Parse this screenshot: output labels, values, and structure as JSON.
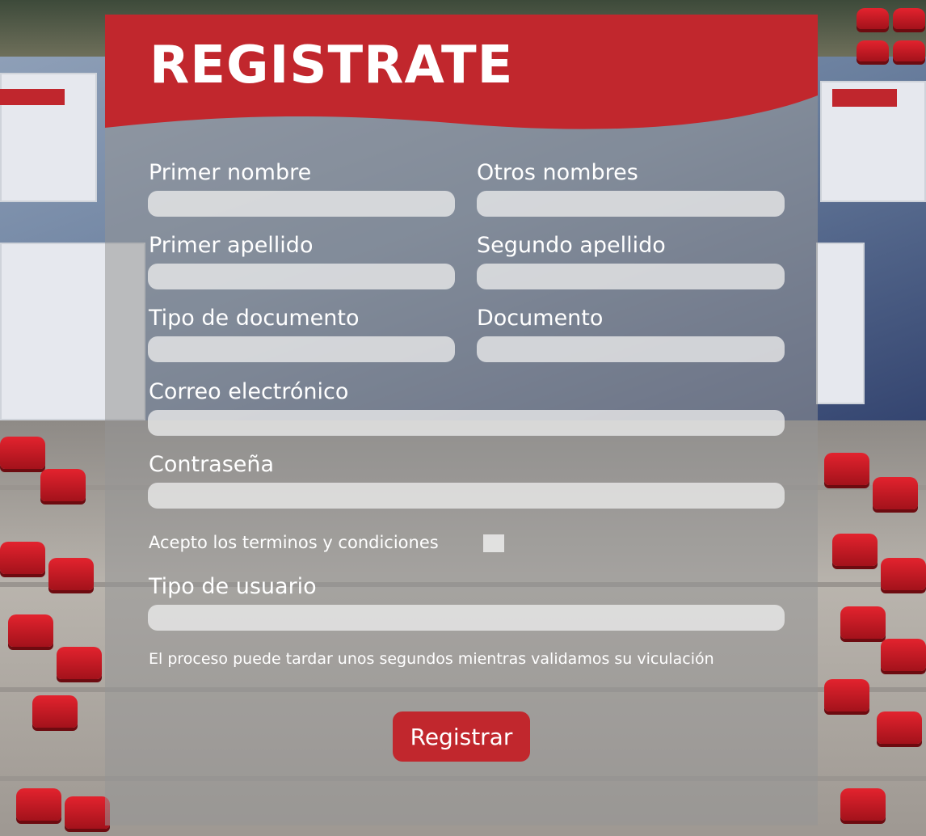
{
  "form": {
    "title": "REGISTRATE",
    "fields": {
      "primer_nombre": {
        "label": "Primer nombre",
        "value": ""
      },
      "otros_nombres": {
        "label": "Otros nombres",
        "value": ""
      },
      "primer_apellido": {
        "label": "Primer apellido",
        "value": ""
      },
      "segundo_apellido": {
        "label": "Segundo apellido",
        "value": ""
      },
      "tipo_documento": {
        "label": "Tipo de documento",
        "value": ""
      },
      "documento": {
        "label": "Documento",
        "value": ""
      },
      "correo": {
        "label": "Correo electrónico",
        "value": ""
      },
      "contrasena": {
        "label": "Contraseña",
        "value": ""
      },
      "tipo_usuario": {
        "label": "Tipo de usuario",
        "value": ""
      }
    },
    "terms_label": "Acepto los terminos  y condiciones",
    "terms_checked": false,
    "note": "El proceso puede tardar unos segundos mientras validamos su viculación",
    "submit_label": "Registrar"
  },
  "colors": {
    "brand_red": "#c1272d",
    "panel_overlay": "rgba(150,150,150,0.55)",
    "input_bg": "#ececec",
    "text": "#ffffff"
  }
}
